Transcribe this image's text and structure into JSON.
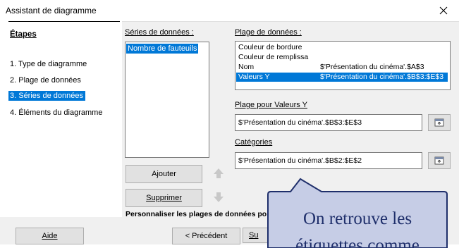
{
  "window": {
    "title": "Assistant de diagramme"
  },
  "steps": {
    "heading": "Étapes",
    "items": [
      {
        "label": "1. Type de diagramme"
      },
      {
        "label": "2. Plage de données"
      },
      {
        "label": "3. Séries de données"
      },
      {
        "label": "4. Éléments du diagramme"
      }
    ]
  },
  "series": {
    "label": "Séries de données :",
    "items": [
      {
        "label": "Nombre de fauteuils"
      }
    ]
  },
  "data_ranges": {
    "label": "Plage de données :",
    "rows": [
      {
        "role": "Couleur de bordure",
        "range": ""
      },
      {
        "role": "Couleur de remplissa",
        "range": ""
      },
      {
        "role": "Nom",
        "range": "$'Présentation du cinéma'.$A$3"
      },
      {
        "role": "Valeurs Y",
        "range": "$'Présentation du cinéma'.$B$3:$E$3"
      }
    ]
  },
  "y_values": {
    "label": "Plage pour Valeurs Y",
    "value": "$'Présentation du cinéma'.$B$3:$E$3"
  },
  "categories": {
    "label": "Catégories",
    "value": "$'Présentation du cinéma'.$B$2:$E$2"
  },
  "buttons": {
    "add": "Ajouter",
    "remove": "Supprimer",
    "help": "Aide",
    "previous": "< Précédent",
    "next_partial": "Su"
  },
  "customize_label": "Personnaliser les plages de données po",
  "callout": {
    "line1": "On retrouve les",
    "line2": "étiquettes comme"
  },
  "colors": {
    "selection": "#0078d7",
    "callout_fill": "#c6cde6",
    "callout_border": "#1f2f6b"
  }
}
